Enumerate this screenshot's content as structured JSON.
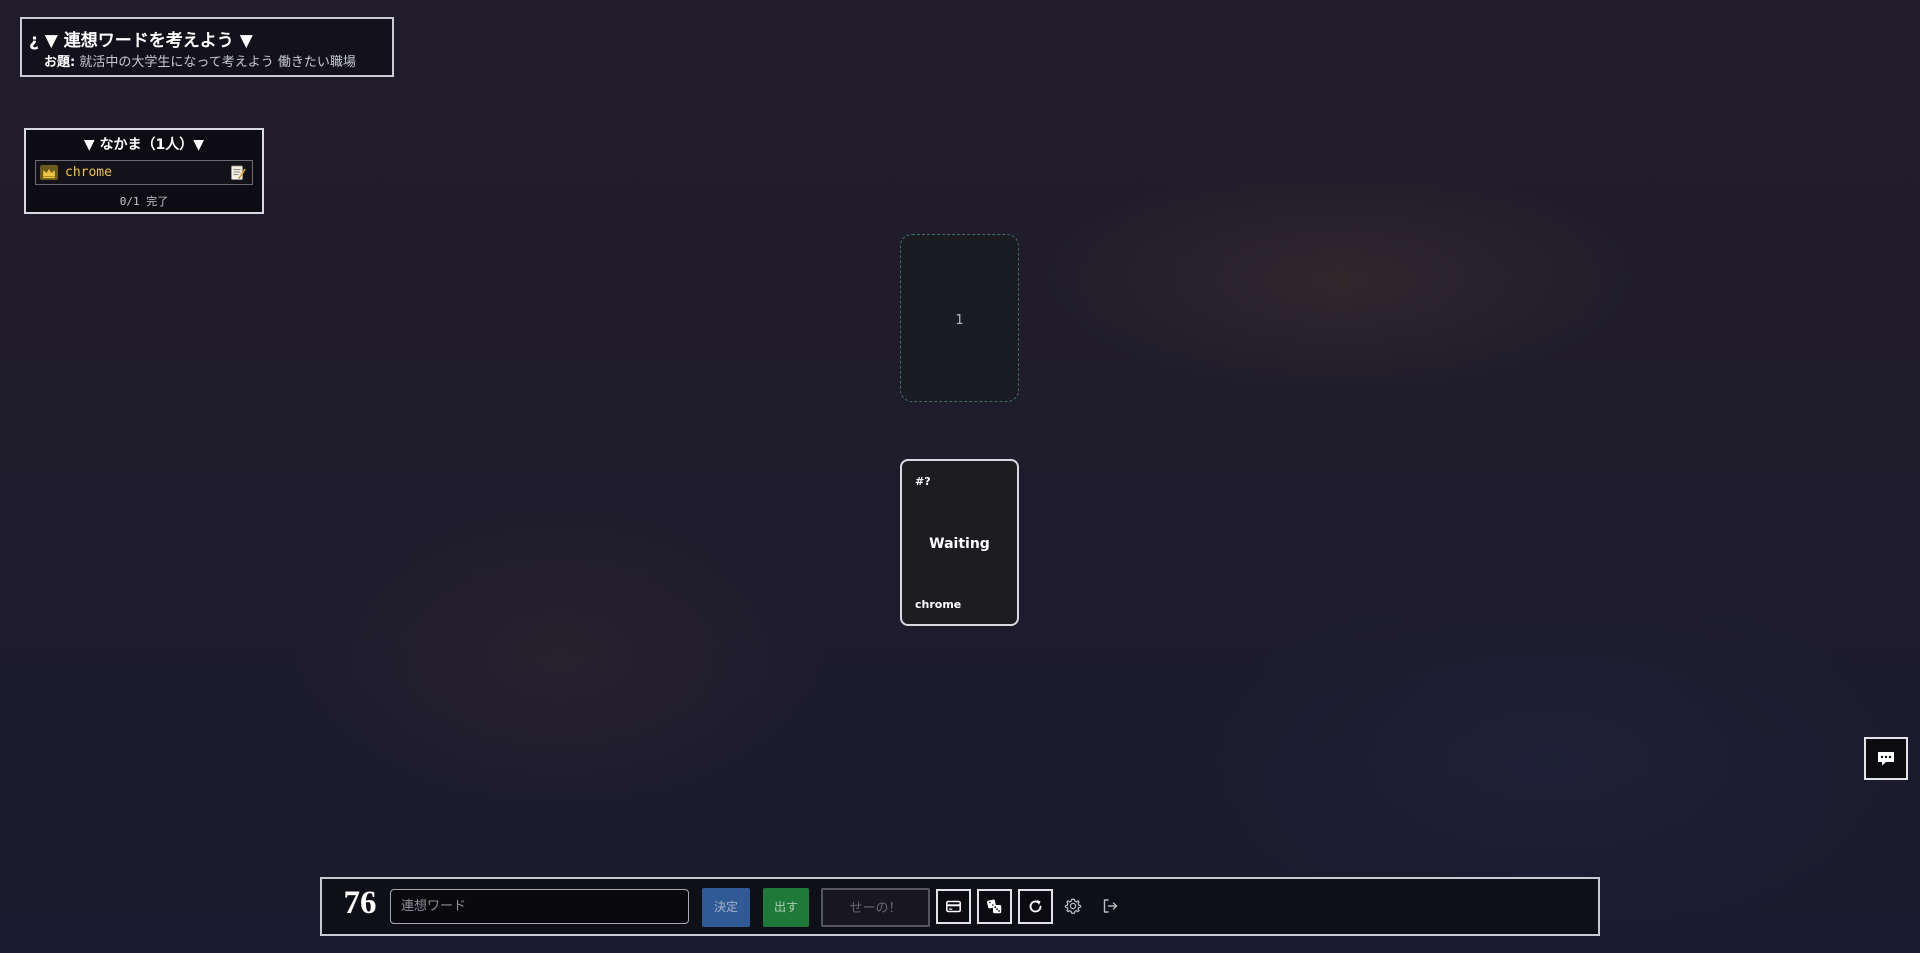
{
  "theme": {
    "title": "¿ ▼ 連想ワードを考えよう ▼",
    "topic_label": "お題:",
    "topic_text": "就活中の大学生になって考えよう 働きたい職場"
  },
  "party": {
    "title": "▼ なかま（1人）▼",
    "members": [
      {
        "name": "chrome",
        "role_icon": "crown-icon",
        "status_icon": "memo-icon"
      }
    ],
    "progress": "0/1 完了"
  },
  "table": {
    "slot_number": "1",
    "card": {
      "number": "#?",
      "status": "Waiting",
      "owner": "chrome"
    }
  },
  "controls": {
    "timer": "76",
    "input_placeholder": "連想ワード",
    "input_value": "",
    "decide_label": "決定",
    "play_label": "出す",
    "seeno_label": "せーの！",
    "icons": [
      "card-icon",
      "dice-icon",
      "reload-icon",
      "gear-icon",
      "exit-icon"
    ]
  },
  "chat": {
    "icon": "chat-icon"
  },
  "colors": {
    "accent_blue": "#2f5a96",
    "accent_green": "#1f7a3a",
    "member_name": "#f0c541",
    "slot_border": "#3e6e6a"
  }
}
